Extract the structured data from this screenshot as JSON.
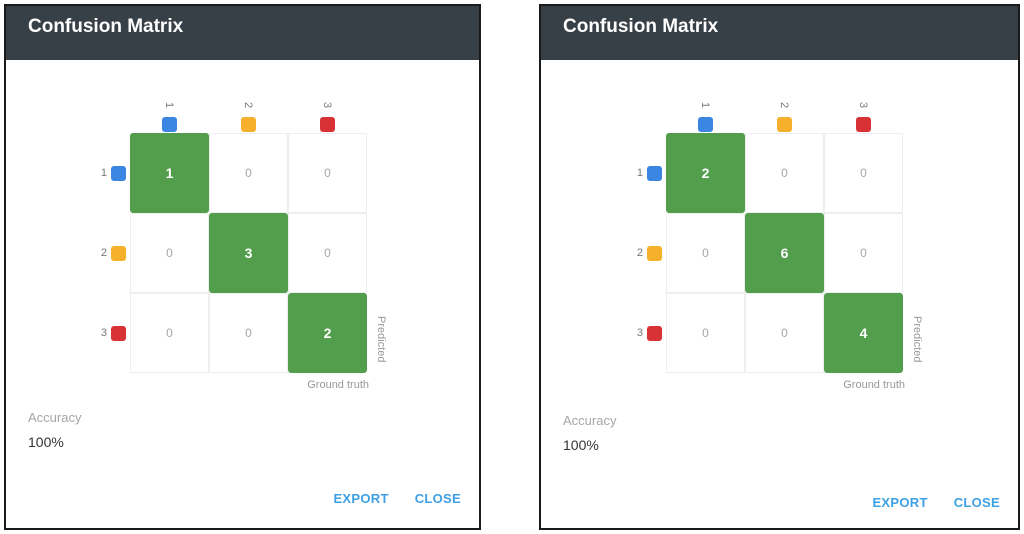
{
  "panels": [
    {
      "title": "Confusion Matrix",
      "classes": [
        {
          "label": "1",
          "color": "#3a86e0"
        },
        {
          "label": "2",
          "color": "#f7b02b"
        },
        {
          "label": "3",
          "color": "#d93236"
        }
      ],
      "matrix": [
        [
          1,
          0,
          0
        ],
        [
          0,
          3,
          0
        ],
        [
          0,
          0,
          2
        ]
      ],
      "axis_predicted": "Predicted",
      "axis_ground_truth": "Ground truth",
      "accuracy_label": "Accuracy",
      "accuracy_value": "100%",
      "export_label": "EXPORT",
      "close_label": "CLOSE"
    },
    {
      "title": "Confusion Matrix",
      "classes": [
        {
          "label": "1",
          "color": "#3a86e0"
        },
        {
          "label": "2",
          "color": "#f7b02b"
        },
        {
          "label": "3",
          "color": "#d93236"
        }
      ],
      "matrix": [
        [
          2,
          0,
          0
        ],
        [
          0,
          6,
          0
        ],
        [
          0,
          0,
          4
        ]
      ],
      "axis_predicted": "Predicted",
      "axis_ground_truth": "Ground truth",
      "accuracy_label": "Accuracy",
      "accuracy_value": "100%",
      "export_label": "EXPORT",
      "close_label": "CLOSE"
    }
  ],
  "colors": {
    "header_bg": "#373f47",
    "diagonal_cell": "#529e4c",
    "action_text": "#3ea0e4"
  }
}
